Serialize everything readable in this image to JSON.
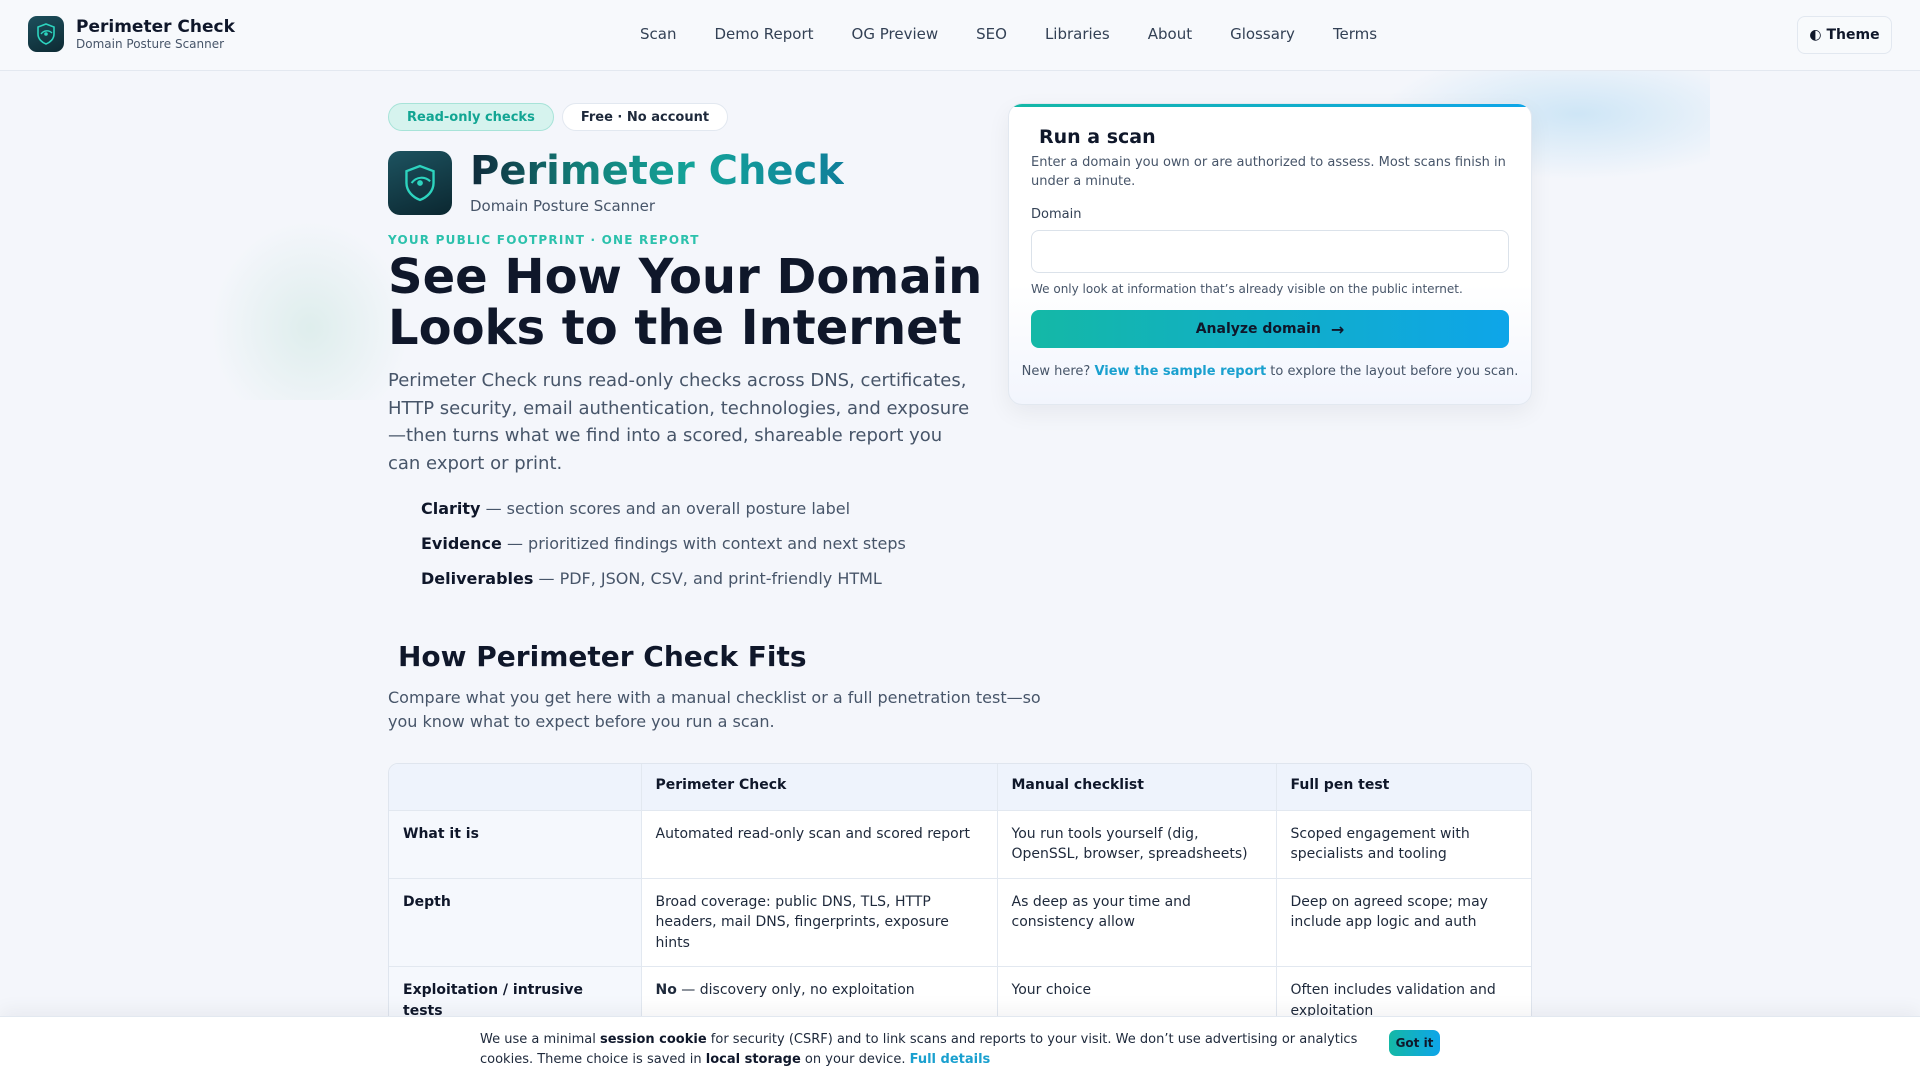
{
  "header": {
    "brand_name": "Perimeter Check",
    "brand_sub": "Domain Posture Scanner",
    "nav": [
      "Scan",
      "Demo Report",
      "OG Preview",
      "SEO",
      "Libraries",
      "About",
      "Glossary",
      "Terms"
    ],
    "theme_label": "◐ Theme"
  },
  "hero": {
    "chips": [
      "Read-only checks",
      "Free · No account"
    ],
    "title_prefix": "Peri",
    "title_rest": "meter Check",
    "subtitle": "Domain Posture Scanner",
    "eyebrow": "YOUR PUBLIC FOOTPRINT · ONE REPORT",
    "headline": "See How Your Domain Looks to the Internet",
    "lead": "Perimeter Check runs read-only checks across DNS, certificates, HTTP security, email authentication, technologies, and exposure—then turns what we find into a scored, shareable report you can export or print.",
    "bullets": [
      {
        "term": "Clarity",
        "desc": " — section scores and an overall posture label"
      },
      {
        "term": "Evidence",
        "desc": " — prioritized findings with context and next steps"
      },
      {
        "term": "Deliverables",
        "desc": " — PDF, JSON, CSV, and print-friendly HTML"
      }
    ]
  },
  "scan_card": {
    "title": "Run a scan",
    "description": "Enter a domain you own or are authorized to assess. Most scans finish in under a minute.",
    "domain_label": "Domain",
    "domain_value": "",
    "domain_placeholder": "",
    "note": "We only look at information that’s already visible on the public internet.",
    "button_label": "Analyze domain",
    "button_arrow": "→",
    "foot_prefix": "New here? ",
    "foot_link": "View the sample report",
    "foot_suffix": " to explore the layout before you scan."
  },
  "fits": {
    "title": "How Perimeter Check Fits",
    "description": "Compare what you get here with a manual checklist or a full penetration test—so you know what to expect before you run a scan.",
    "columns": [
      "",
      "Perimeter Check",
      "Manual checklist",
      "Full pen test"
    ],
    "rows": [
      {
        "label": "What it is",
        "cells": [
          "Automated read-only scan and scored report",
          "You run tools yourself (dig, OpenSSL, browser, spreadsheets)",
          "Scoped engagement with specialists and tooling"
        ]
      },
      {
        "label": "Depth",
        "cells": [
          "Broad coverage: public DNS, TLS, HTTP headers, mail DNS, fingerprints, exposure hints",
          "As deep as your time and consistency allow",
          "Deep on agreed scope; may include app logic and auth"
        ]
      },
      {
        "label": "Exploitation / intrusive tests",
        "cells_strong": "No",
        "cells_rest": " — discovery only, no exploitation",
        "cells": [
          "",
          "Your choice",
          "Often includes validation and exploitation"
        ]
      }
    ]
  },
  "cookie": {
    "t1": "We use a minimal ",
    "b1": "session cookie",
    "t2": " for security (CSRF) and to link scans and reports to your visit. We don’t use advertising or analytics cookies. Theme choice is saved in ",
    "b2": "local storage",
    "t3": " on your device. ",
    "link": "Full details",
    "button": "Got it"
  },
  "colors": {
    "accent_teal": "#14b8a6",
    "accent_blue": "#0ea5e9",
    "link": "#1aa0cf",
    "eyebrow": "#2cc1ac"
  }
}
